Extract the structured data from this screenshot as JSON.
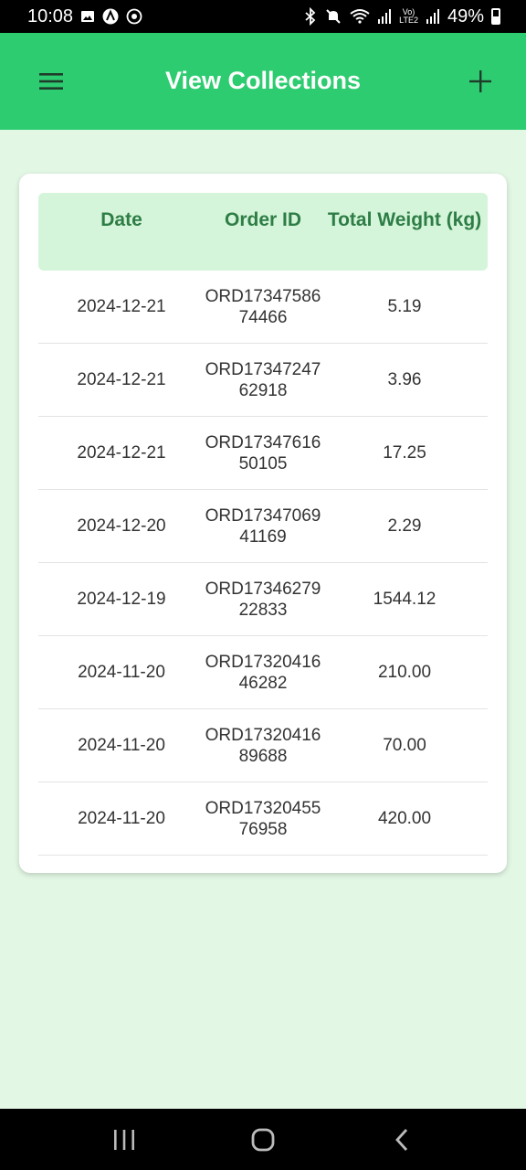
{
  "status_bar": {
    "time": "10:08",
    "battery_text": "49%",
    "icons": [
      "gallery-icon",
      "app-icon",
      "whatsapp-icon",
      "bluetooth-icon",
      "mute-icon",
      "wifi-icon",
      "signal-icon",
      "volte-icon",
      "battery-icon"
    ]
  },
  "app_bar": {
    "title": "View Collections",
    "menu_icon": "menu-icon",
    "add_icon": "add-icon",
    "background": "#2ecc71"
  },
  "table": {
    "headers": [
      "Date",
      "Order ID",
      "Total Weight (kg)"
    ],
    "rows": [
      {
        "date": "2024-12-21",
        "order_id": "ORD1734758674466",
        "weight": "5.19"
      },
      {
        "date": "2024-12-21",
        "order_id": "ORD1734724762918",
        "weight": "3.96"
      },
      {
        "date": "2024-12-21",
        "order_id": "ORD1734761650105",
        "weight": "17.25"
      },
      {
        "date": "2024-12-20",
        "order_id": "ORD1734706941169",
        "weight": "2.29"
      },
      {
        "date": "2024-12-19",
        "order_id": "ORD1734627922833",
        "weight": "1544.12"
      },
      {
        "date": "2024-11-20",
        "order_id": "ORD1732041646282",
        "weight": "210.00"
      },
      {
        "date": "2024-11-20",
        "order_id": "ORD1732041689688",
        "weight": "70.00"
      },
      {
        "date": "2024-11-20",
        "order_id": "ORD1732045576958",
        "weight": "420.00"
      }
    ]
  },
  "nav_bar": {
    "icons": [
      "recent-apps-icon",
      "home-icon",
      "back-icon"
    ]
  }
}
